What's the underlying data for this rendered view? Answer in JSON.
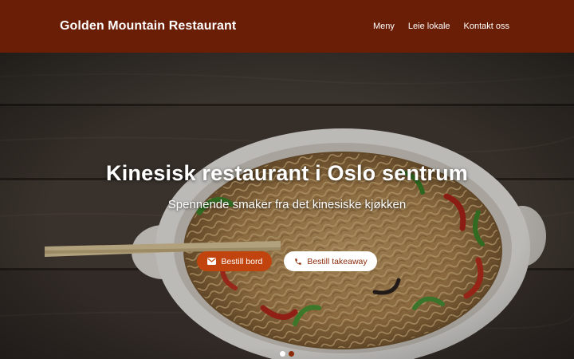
{
  "header": {
    "brand": "Golden Mountain Restaurant",
    "nav": [
      {
        "label": "Meny"
      },
      {
        "label": "Leie lokale"
      },
      {
        "label": "Kontakt oss"
      }
    ]
  },
  "hero": {
    "title": "Kinesisk restaurant i Oslo sentrum",
    "subtitle": "Spennende smaker fra det kinesiske kjøkken",
    "buttons": {
      "book_label": "Bestill bord",
      "book_icon": "envelope-icon",
      "takeaway_label": "Bestill takeaway",
      "takeaway_icon": "phone-icon"
    },
    "carousel_slides": 2,
    "carousel_active": 1
  },
  "colors": {
    "header_bg": "#6b1e06",
    "primary_button": "#c1440e",
    "accent_text": "#8a2a08"
  }
}
